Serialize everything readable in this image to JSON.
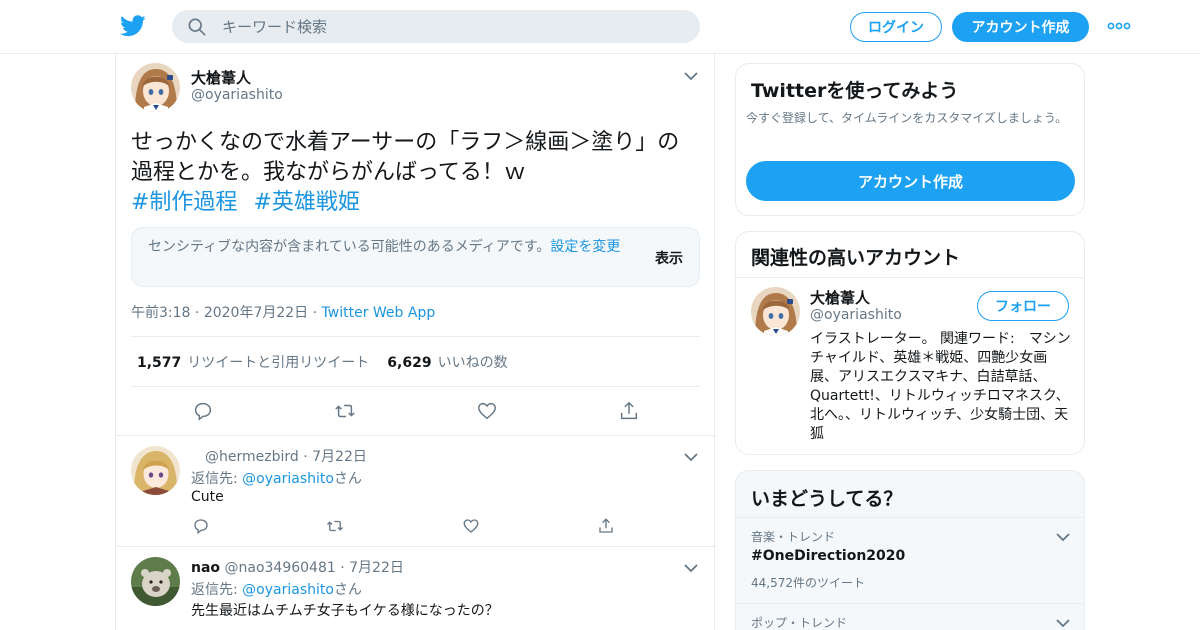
{
  "header": {
    "search_placeholder": "キーワード検索",
    "login_label": "ログイン",
    "signup_label": "アカウント作成",
    "brand_color": "#1da1f2"
  },
  "tweet": {
    "author_name": "大槍葦人",
    "author_handle": "@oyariashito",
    "text": "せっかくなので水着アーサーの「ラフ＞線画＞塗り」の過程とかを。我ながらがんばってる！ｗ",
    "hashtags": [
      "#制作過程",
      "#英雄戦姫"
    ],
    "sensitive_notice": "センシティブな内容が含まれている可能性のあるメディアです。",
    "sensitive_settings_link": "設定を変更",
    "sensitive_show": "表示",
    "time": "午前3:18",
    "date": "2020年7月22日",
    "source": "Twitter Web App",
    "retweet_count": "1,577",
    "retweet_label": "リツイートと引用リツイート",
    "like_count": "6,629",
    "like_label": "いいねの数"
  },
  "replies": [
    {
      "name": "",
      "handle": "@hermezbird",
      "date": "7月22日",
      "reply_to_prefix": "返信先: ",
      "reply_to_handle": "@oyariashito",
      "reply_to_suffix": "さん",
      "text": "Cute"
    },
    {
      "name": "nao",
      "handle": "@nao34960481",
      "date": "7月22日",
      "reply_to_prefix": "返信先: ",
      "reply_to_handle": "@oyariashito",
      "reply_to_suffix": "さん",
      "text": "先生最近はムチムチ女子もイケる様になったの？"
    }
  ],
  "sidebar": {
    "try_card": {
      "title": "Twitterを使ってみよう",
      "subtitle": "今すぐ登録して、タイムラインをカスタマイズしましょう。",
      "button": "アカウント作成"
    },
    "related": {
      "title": "関連性の高いアカウント",
      "name": "大槍葦人",
      "handle": "@oyariashito",
      "follow_label": "フォロー",
      "bio": "イラストレーター。 関連ワード:　マシンチャイルド、英雄＊戦姫、四艶少女画展、アリスエクスマキナ、白詰草話、Quartett!、リトルウィッチロマネスク、北へ。、リトルウィッチ、少女騎士団、天狐"
    },
    "trends": {
      "title": "いまどうしてる？",
      "items": [
        {
          "category": "音楽・トレンド",
          "name": "#OneDirection2020",
          "count": "44,572件のツイート"
        },
        {
          "category": "ポップ・トレンド",
          "name": "",
          "count": ""
        }
      ]
    }
  }
}
